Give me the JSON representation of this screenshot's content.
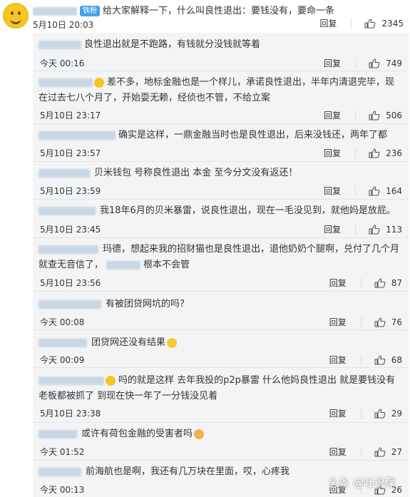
{
  "top_comment": {
    "badge": "铁粉",
    "text": "给大家解释一下，什么叫良性退出：要钱没有，要命一条",
    "time": "5月10日 20:03",
    "reply": "回复",
    "likes": "2345"
  },
  "replies": [
    {
      "text": "良性退出就是不跑路，有钱就分没钱就等着",
      "time": "今天 00:16",
      "reply": "回复",
      "likes": "749"
    },
    {
      "text": "差不多，地标金融也是一个样儿，承诺良性退出，半年内清退完毕，现在过去七八个月了，开始耍无赖，经侦也不管，不给立案",
      "time": "5月10日 23:17",
      "reply": "回复",
      "likes": "506"
    },
    {
      "text": "确实是这样，一鼎金融当时也是良性退出，后来没钱还，两年了都",
      "time": "5月10日 23:57",
      "reply": "回复",
      "likes": "236"
    },
    {
      "text": "贝米钱包 号称良性退出 本金 至今分文没有返还！",
      "time": "5月10日 23:59",
      "reply": "回复",
      "likes": "164"
    },
    {
      "text": "我18年6月的贝米暴雷，说良性退出，现在一毛没见到，就他妈是放屁。",
      "time": "5月10日 23:45",
      "reply": "回复",
      "likes": "113"
    },
    {
      "text": "玛德，想起来我的招财猫也是良性退出，退他奶奶个腿啊，兑付了几个月就查无音信了，",
      "text2": "根本不会管",
      "time": "5月10日 23:56",
      "reply": "回复",
      "likes": "87"
    },
    {
      "text": "有被团贷网坑的吗?",
      "time": "今天 00:08",
      "reply": "回复",
      "likes": "76"
    },
    {
      "text": "团贷网还没有结果",
      "time": "今天 00:09",
      "reply": "回复",
      "likes": "68"
    },
    {
      "text": "吗的就是这样 去年我投的p2p暴雷 什么他妈良性退出 就是要钱没有老板都被抓了 到现在快一年了一分钱没见着",
      "time": "5月10日 23:38",
      "reply": "回复",
      "likes": "29"
    },
    {
      "text": "或许有荷包金融的受害者吗",
      "time": "今天 01:52",
      "reply": "回复",
      "likes": "27"
    },
    {
      "text": "前海航也是啊，我还有几万块在里面，哎，心疼我",
      "time": "今天 00:13",
      "reply": "回复",
      "likes": "26"
    }
  ],
  "watermark": "头条 @吐逗保",
  "colors": {
    "sub_bg": "#f3f4f6",
    "badge": "#4aa0e8",
    "divider": "#e3e4e7"
  }
}
